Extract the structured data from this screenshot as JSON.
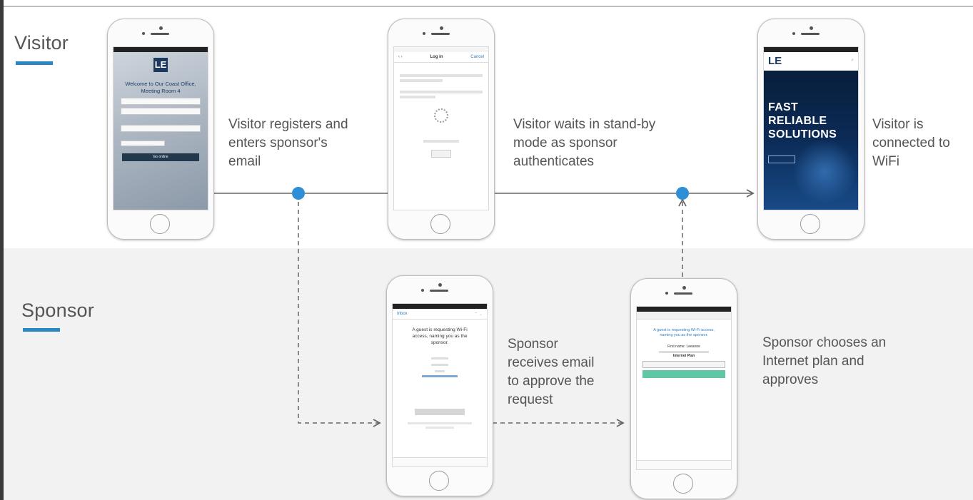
{
  "lanes": {
    "visitor": {
      "label": "Visitor"
    },
    "sponsor": {
      "label": "Sponsor"
    }
  },
  "steps": {
    "visitor_registers": "Visitor registers and\nenters sponsor's\nemail",
    "visitor_waits": "Visitor waits in stand-by\nmode as sponsor\nauthenticates",
    "visitor_connected": "Visitor is\nconnected to\nWiFi",
    "sponsor_receives": "Sponsor\nreceives email\nto approve the\nrequest",
    "sponsor_chooses": "Sponsor chooses an\nInternet plan and\napproves"
  },
  "screens": {
    "registration": {
      "logo": "LE",
      "title": "Welcome to Our Coast Office,\nMeeting Room 4",
      "cta": "Go online"
    },
    "standby": {
      "nav_title": "Log in",
      "nav_cancel": "Cancel"
    },
    "connected": {
      "logo": "LE",
      "headline": "FAST\nRELIABLE\nSOLUTIONS"
    },
    "approval_email": {
      "back": "Inbox",
      "heading": "A guest is requesting Wi-Fi\naccess, naming you as the\nsponsor."
    },
    "plan": {
      "heading": "A guest is requesting Wi-Fi access,\nnaming you as the sponsor.",
      "first_name": "First name: Leeanne",
      "plan_label": "Internet Plan"
    }
  },
  "colors": {
    "accent_blue": "#2b87c4",
    "node_blue": "#2f8fd6",
    "sponsor_band": "#f2f2f2",
    "connector": "#666666"
  }
}
